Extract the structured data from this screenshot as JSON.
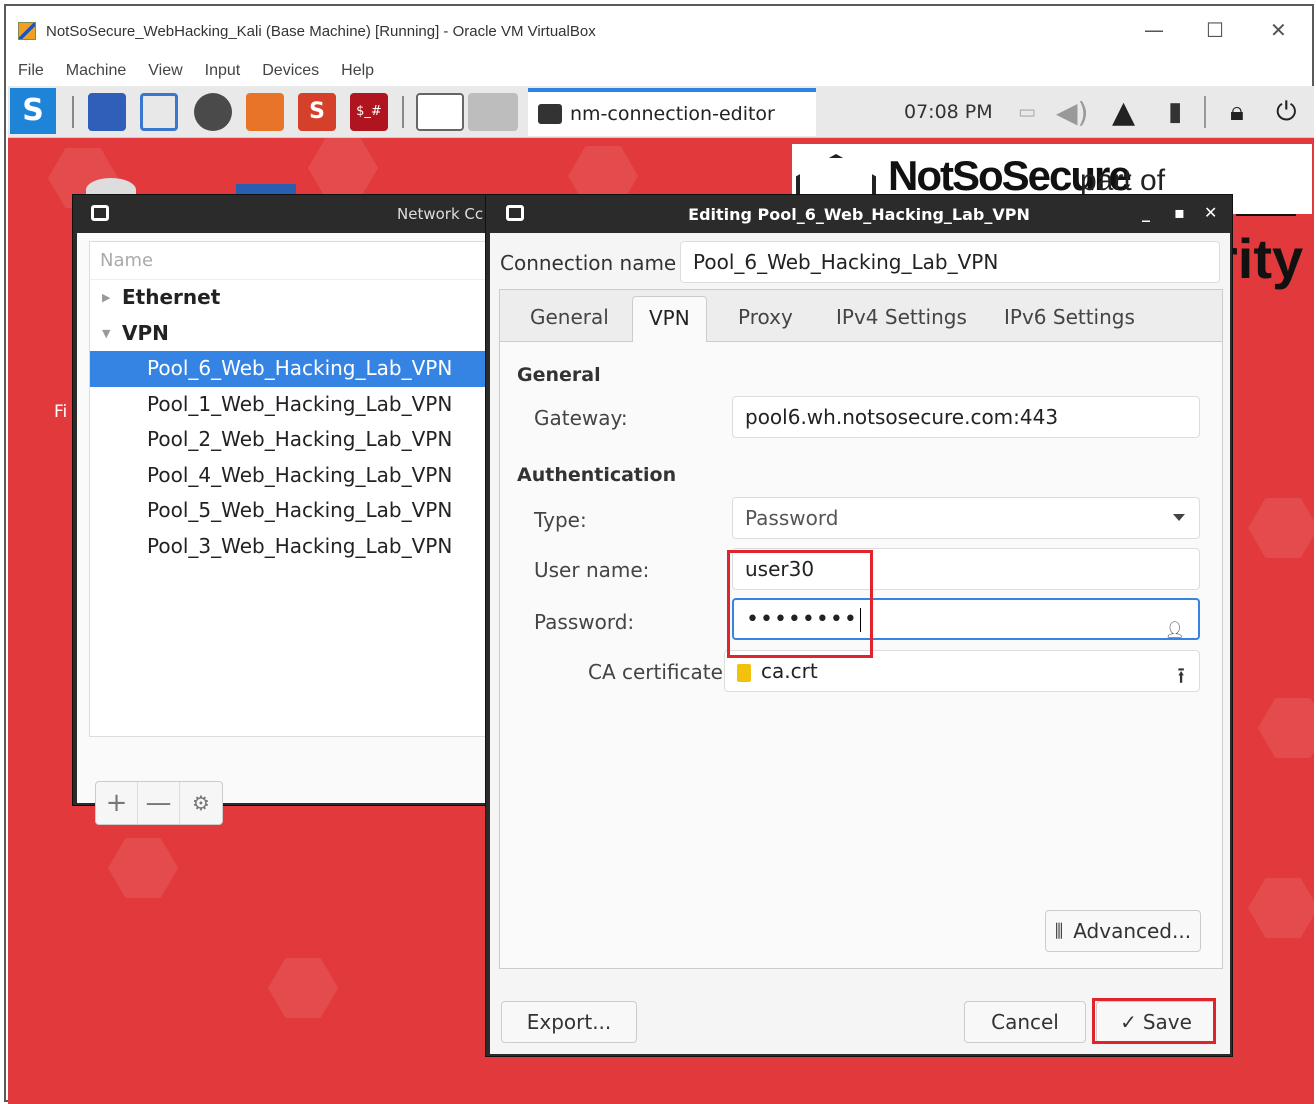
{
  "host": {
    "title": "NotSoSecure_WebHacking_Kali (Base Machine) [Running] - Oracle VM VirtualBox",
    "menu": [
      "File",
      "Machine",
      "View",
      "Input",
      "Devices",
      "Help"
    ]
  },
  "panel": {
    "task_label": "nm-connection-editor",
    "clock": "07:08 PM"
  },
  "desktop": {
    "brand_main": "NotSoSecure",
    "brand_sub": "part of",
    "brand_tail": "rity",
    "icon_label_fragment": "Fi"
  },
  "network_window": {
    "title_fragment": "Network Cc",
    "column_header": "Name",
    "groups": [
      {
        "label": "Ethernet"
      },
      {
        "label": "VPN"
      }
    ],
    "vpn_items": [
      "Pool_6_Web_Hacking_Lab_VPN",
      "Pool_1_Web_Hacking_Lab_VPN",
      "Pool_2_Web_Hacking_Lab_VPN",
      "Pool_4_Web_Hacking_Lab_VPN",
      "Pool_5_Web_Hacking_Lab_VPN",
      "Pool_3_Web_Hacking_Lab_VPN"
    ],
    "selected_item": "Pool_6_Web_Hacking_Lab_VPN"
  },
  "editor": {
    "title": "Editing Pool_6_Web_Hacking_Lab_VPN",
    "connection_name_label": "Connection name",
    "connection_name_value": "Pool_6_Web_Hacking_Lab_VPN",
    "tabs": [
      "General",
      "VPN",
      "Proxy",
      "IPv4 Settings",
      "IPv6 Settings"
    ],
    "active_tab": "VPN",
    "section_general": "General",
    "gateway_label": "Gateway:",
    "gateway_value": "pool6.wh.notsosecure.com:443",
    "section_auth": "Authentication",
    "type_label": "Type:",
    "type_value": "Password",
    "username_label": "User name:",
    "username_value": "user30",
    "password_label": "Password:",
    "password_value": "••••••••",
    "ca_label": "CA certificate",
    "ca_value": "ca.crt",
    "advanced_label": "Advanced...",
    "export_label": "Export...",
    "cancel_label": "Cancel",
    "save_label": "Save"
  },
  "colors": {
    "desktop_red": "#e23a3c",
    "selection_blue": "#3584e4",
    "highlight_red": "#e0242c"
  }
}
